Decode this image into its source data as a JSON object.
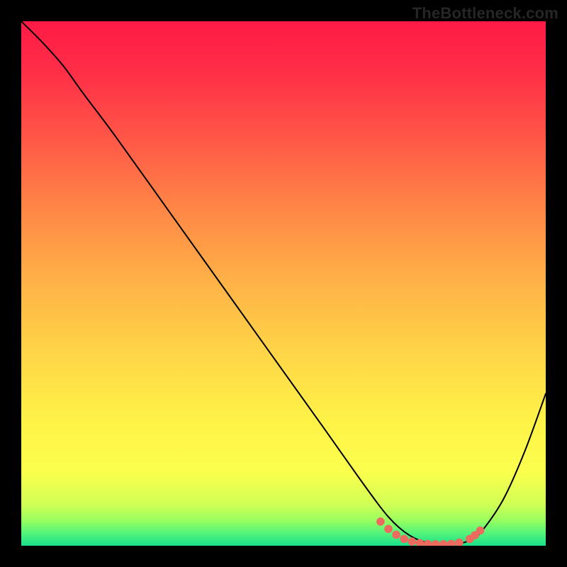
{
  "watermark": "TheBottleneck.com",
  "chart_data": {
    "type": "line",
    "title": "",
    "xlabel": "",
    "ylabel": "",
    "xlim": [
      0,
      100
    ],
    "ylim": [
      0,
      100
    ],
    "series": [
      {
        "name": "curve",
        "x": [
          0,
          4,
          8,
          12,
          18,
          28,
          38,
          48,
          58,
          64,
          68,
          70,
          72,
          74,
          76,
          78,
          80,
          82,
          84,
          86,
          88,
          92,
          96,
          100
        ],
        "y": [
          100,
          96,
          91.5,
          86,
          78,
          64,
          50,
          36,
          22,
          13.5,
          8,
          5.5,
          3.5,
          2,
          1,
          0.5,
          0.3,
          0.3,
          0.5,
          1.3,
          3,
          9,
          18,
          29
        ]
      }
    ],
    "markers": {
      "name": "flat-region-dots",
      "color": "#ec6a5e",
      "points": [
        {
          "x": 68.5,
          "y": 4.6
        },
        {
          "x": 70.0,
          "y": 3.2
        },
        {
          "x": 71.5,
          "y": 2.1
        },
        {
          "x": 73.0,
          "y": 1.3
        },
        {
          "x": 74.5,
          "y": 0.8
        },
        {
          "x": 76.0,
          "y": 0.5
        },
        {
          "x": 77.5,
          "y": 0.35
        },
        {
          "x": 79.0,
          "y": 0.3
        },
        {
          "x": 80.5,
          "y": 0.3
        },
        {
          "x": 82.0,
          "y": 0.35
        },
        {
          "x": 83.5,
          "y": 0.6
        },
        {
          "x": 85.5,
          "y": 1.3
        },
        {
          "x": 86.5,
          "y": 2.0
        },
        {
          "x": 87.5,
          "y": 2.9
        }
      ]
    },
    "background": {
      "stops": [
        {
          "offset": 0.0,
          "color": "#ff1a46"
        },
        {
          "offset": 0.1,
          "color": "#ff2f47"
        },
        {
          "offset": 0.22,
          "color": "#ff5647"
        },
        {
          "offset": 0.36,
          "color": "#ff8747"
        },
        {
          "offset": 0.5,
          "color": "#ffb347"
        },
        {
          "offset": 0.64,
          "color": "#ffd747"
        },
        {
          "offset": 0.76,
          "color": "#fff247"
        },
        {
          "offset": 0.86,
          "color": "#fbff4d"
        },
        {
          "offset": 0.92,
          "color": "#d2ff55"
        },
        {
          "offset": 0.95,
          "color": "#9cff5e"
        },
        {
          "offset": 0.975,
          "color": "#56f57a"
        },
        {
          "offset": 1.0,
          "color": "#18e08a"
        }
      ]
    }
  }
}
